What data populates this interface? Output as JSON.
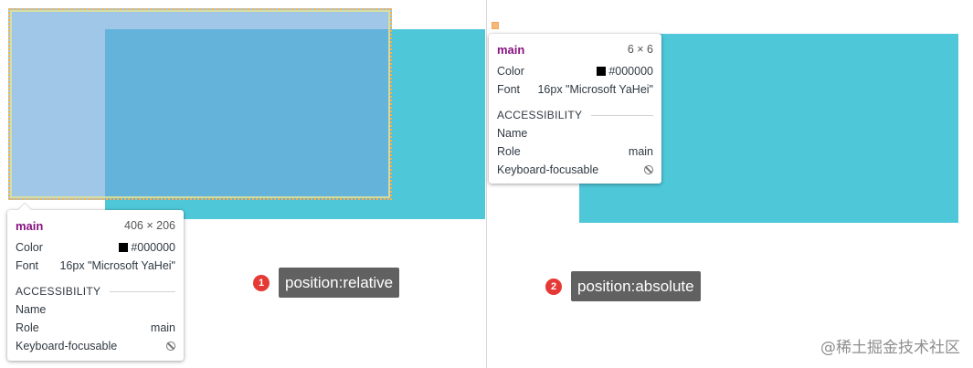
{
  "left": {
    "tooltip": {
      "element": "main",
      "dims": "406 × 206",
      "color_label": "Color",
      "color_value": "#000000",
      "font_label": "Font",
      "font_value": "16px \"Microsoft YaHei\"",
      "section": "ACCESSIBILITY",
      "name_label": "Name",
      "role_label": "Role",
      "role_value": "main",
      "kb_label": "Keyboard-focusable"
    },
    "callout": {
      "number": "1",
      "text": "position:relative"
    }
  },
  "right": {
    "tooltip": {
      "element": "main",
      "dims": "6 × 6",
      "color_label": "Color",
      "color_value": "#000000",
      "font_label": "Font",
      "font_value": "16px \"Microsoft YaHei\"",
      "section": "ACCESSIBILITY",
      "name_label": "Name",
      "role_label": "Role",
      "role_value": "main",
      "kb_label": "Keyboard-focusable"
    },
    "callout": {
      "number": "2",
      "text": "position:absolute"
    }
  },
  "watermark": "@稀土掘金技术社区",
  "colors": {
    "cyan": "#4ec8d9",
    "overlay": "#6fa8dc",
    "title": "#881280",
    "badge": "#e53935",
    "pill": "#616161"
  },
  "icons": {
    "not_focusable": "no-entry-icon"
  }
}
